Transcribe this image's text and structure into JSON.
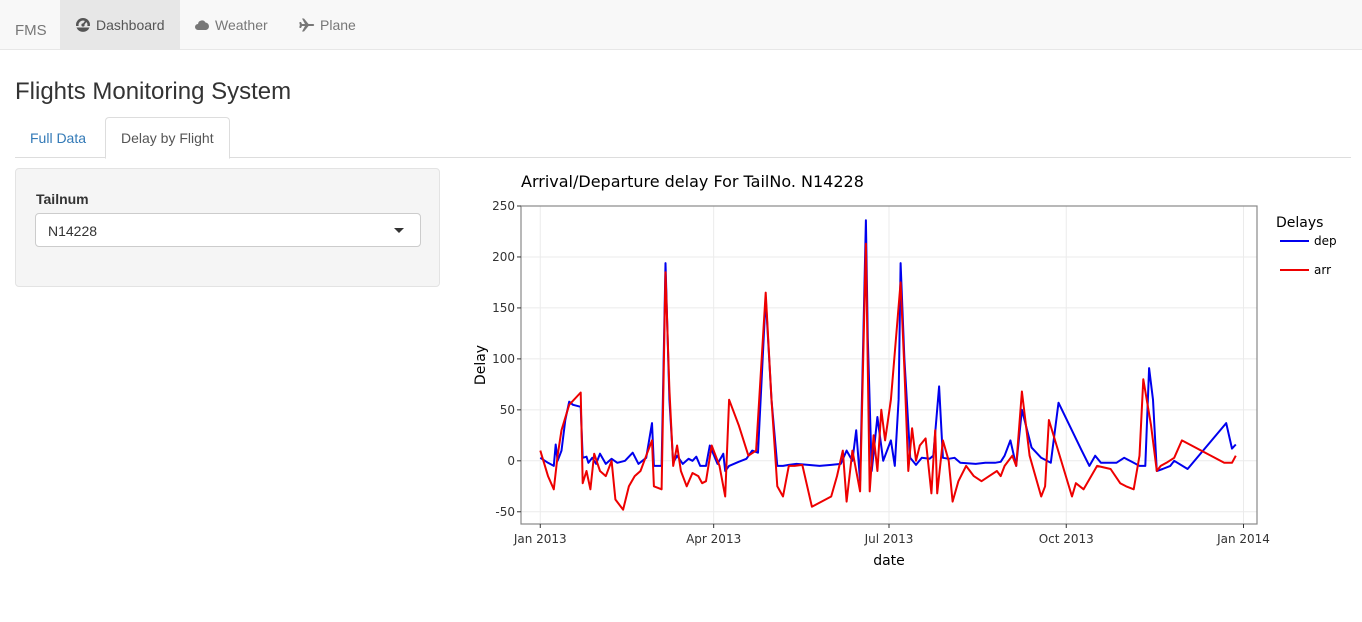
{
  "navbar": {
    "brand": "FMS",
    "items": [
      {
        "label": "Dashboard",
        "icon": "dashboard-icon",
        "active": true
      },
      {
        "label": "Weather",
        "icon": "cloud-icon",
        "active": false
      },
      {
        "label": "Plane",
        "icon": "plane-icon",
        "active": false
      }
    ]
  },
  "page": {
    "title": "Flights Monitoring System"
  },
  "tabs": [
    {
      "label": "Full Data",
      "active": false
    },
    {
      "label": "Delay by Flight",
      "active": true
    }
  ],
  "sidebar": {
    "tailnum_label": "Tailnum",
    "tailnum_value": "N14228"
  },
  "colors": {
    "dep": "#0000ee",
    "arr": "#ee0000",
    "link": "#337ab7"
  },
  "chart_data": {
    "type": "line",
    "title": "Arrival/Departure delay For TailNo. N14228",
    "xlabel": "date",
    "ylabel": "Delay",
    "legend_title": "Delays",
    "legend_position": "right",
    "grid": true,
    "xlim": [
      "2012-12-22",
      "2014-01-08"
    ],
    "ylim": [
      -62,
      250
    ],
    "x_ticks": [
      {
        "date": "2013-01-01",
        "label": "Jan 2013"
      },
      {
        "date": "2013-04-01",
        "label": "Apr 2013"
      },
      {
        "date": "2013-07-01",
        "label": "Jul 2013"
      },
      {
        "date": "2013-10-01",
        "label": "Oct 2013"
      },
      {
        "date": "2014-01-01",
        "label": "Jan 2014"
      }
    ],
    "y_ticks": [
      -50,
      0,
      50,
      100,
      150,
      200,
      250
    ],
    "series": [
      {
        "name": "dep",
        "points": [
          [
            "2013-01-01",
            3
          ],
          [
            "2013-01-05",
            -2
          ],
          [
            "2013-01-08",
            -5
          ],
          [
            "2013-01-09",
            16
          ],
          [
            "2013-01-10",
            0
          ],
          [
            "2013-01-12",
            10
          ],
          [
            "2013-01-14",
            40
          ],
          [
            "2013-01-16",
            58
          ],
          [
            "2013-01-18",
            55
          ],
          [
            "2013-01-22",
            53
          ],
          [
            "2013-01-23",
            3
          ],
          [
            "2013-01-25",
            4
          ],
          [
            "2013-01-26",
            -2
          ],
          [
            "2013-01-28",
            3
          ],
          [
            "2013-01-30",
            -3
          ],
          [
            "2013-02-01",
            7
          ],
          [
            "2013-02-04",
            -3
          ],
          [
            "2013-02-07",
            2
          ],
          [
            "2013-02-10",
            -2
          ],
          [
            "2013-02-14",
            0
          ],
          [
            "2013-02-18",
            8
          ],
          [
            "2013-02-21",
            -3
          ],
          [
            "2013-02-25",
            3
          ],
          [
            "2013-02-28",
            37
          ],
          [
            "2013-03-01",
            -5
          ],
          [
            "2013-03-05",
            -5
          ],
          [
            "2013-03-07",
            194
          ],
          [
            "2013-03-09",
            60
          ],
          [
            "2013-03-11",
            -2
          ],
          [
            "2013-03-13",
            5
          ],
          [
            "2013-03-16",
            -3
          ],
          [
            "2013-03-19",
            2
          ],
          [
            "2013-03-21",
            0
          ],
          [
            "2013-03-23",
            4
          ],
          [
            "2013-03-25",
            -5
          ],
          [
            "2013-03-28",
            -5
          ],
          [
            "2013-03-30",
            15
          ],
          [
            "2013-04-03",
            -3
          ],
          [
            "2013-04-06",
            7
          ],
          [
            "2013-04-07",
            -10
          ],
          [
            "2013-04-09",
            -5
          ],
          [
            "2013-04-14",
            -1
          ],
          [
            "2013-04-18",
            2
          ],
          [
            "2013-04-21",
            10
          ],
          [
            "2013-04-24",
            8
          ],
          [
            "2013-04-28",
            160
          ],
          [
            "2013-05-01",
            60
          ],
          [
            "2013-05-04",
            -5
          ],
          [
            "2013-05-07",
            -5
          ],
          [
            "2013-05-10",
            -4
          ],
          [
            "2013-05-14",
            -3
          ],
          [
            "2013-05-20",
            -4
          ],
          [
            "2013-05-26",
            -5
          ],
          [
            "2013-06-01",
            -4
          ],
          [
            "2013-06-06",
            -3
          ],
          [
            "2013-06-09",
            10
          ],
          [
            "2013-06-12",
            0
          ],
          [
            "2013-06-14",
            30
          ],
          [
            "2013-06-16",
            -20
          ],
          [
            "2013-06-19",
            236
          ],
          [
            "2013-06-20",
            120
          ],
          [
            "2013-06-22",
            -10
          ],
          [
            "2013-06-25",
            43
          ],
          [
            "2013-06-28",
            0
          ],
          [
            "2013-07-02",
            20
          ],
          [
            "2013-07-04",
            -5
          ],
          [
            "2013-07-06",
            60
          ],
          [
            "2013-07-07",
            194
          ],
          [
            "2013-07-09",
            100
          ],
          [
            "2013-07-12",
            3
          ],
          [
            "2013-07-15",
            -4
          ],
          [
            "2013-07-18",
            3
          ],
          [
            "2013-07-22",
            2
          ],
          [
            "2013-07-24",
            5
          ],
          [
            "2013-07-27",
            73
          ],
          [
            "2013-07-29",
            3
          ],
          [
            "2013-08-01",
            2
          ],
          [
            "2013-08-04",
            3
          ],
          [
            "2013-08-07",
            -2
          ],
          [
            "2013-08-15",
            -3
          ],
          [
            "2013-08-20",
            -2
          ],
          [
            "2013-08-25",
            -2
          ],
          [
            "2013-08-28",
            -1
          ],
          [
            "2013-08-30",
            5
          ],
          [
            "2013-09-02",
            20
          ],
          [
            "2013-09-05",
            -5
          ],
          [
            "2013-09-08",
            50
          ],
          [
            "2013-09-13",
            13
          ],
          [
            "2013-09-18",
            3
          ],
          [
            "2013-09-23",
            -2
          ],
          [
            "2013-09-27",
            57
          ],
          [
            "2013-10-09",
            10
          ],
          [
            "2013-10-13",
            -5
          ],
          [
            "2013-10-16",
            5
          ],
          [
            "2013-10-19",
            -2
          ],
          [
            "2013-10-23",
            -2
          ],
          [
            "2013-10-27",
            -2
          ],
          [
            "2013-10-31",
            3
          ],
          [
            "2013-11-04",
            -1
          ],
          [
            "2013-11-08",
            -5
          ],
          [
            "2013-11-11",
            -5
          ],
          [
            "2013-11-13",
            91
          ],
          [
            "2013-11-15",
            60
          ],
          [
            "2013-11-17",
            -10
          ],
          [
            "2013-11-20",
            -8
          ],
          [
            "2013-11-24",
            -5
          ],
          [
            "2013-11-26",
            0
          ],
          [
            "2013-12-03",
            -8
          ],
          [
            "2013-12-23",
            37
          ],
          [
            "2013-12-26",
            12
          ],
          [
            "2013-12-28",
            16
          ]
        ]
      },
      {
        "name": "arr",
        "points": [
          [
            "2013-01-01",
            10
          ],
          [
            "2013-01-05",
            -15
          ],
          [
            "2013-01-08",
            -28
          ],
          [
            "2013-01-10",
            5
          ],
          [
            "2013-01-12",
            30
          ],
          [
            "2013-01-16",
            55
          ],
          [
            "2013-01-22",
            67
          ],
          [
            "2013-01-23",
            -22
          ],
          [
            "2013-01-25",
            -10
          ],
          [
            "2013-01-27",
            -28
          ],
          [
            "2013-01-29",
            7
          ],
          [
            "2013-02-01",
            -10
          ],
          [
            "2013-02-04",
            -15
          ],
          [
            "2013-02-07",
            0
          ],
          [
            "2013-02-09",
            -38
          ],
          [
            "2013-02-13",
            -48
          ],
          [
            "2013-02-16",
            -25
          ],
          [
            "2013-02-19",
            -15
          ],
          [
            "2013-02-22",
            -10
          ],
          [
            "2013-02-25",
            5
          ],
          [
            "2013-02-28",
            20
          ],
          [
            "2013-03-01",
            -25
          ],
          [
            "2013-03-05",
            -28
          ],
          [
            "2013-03-07",
            185
          ],
          [
            "2013-03-09",
            70
          ],
          [
            "2013-03-11",
            -5
          ],
          [
            "2013-03-13",
            15
          ],
          [
            "2013-03-15",
            -10
          ],
          [
            "2013-03-18",
            -25
          ],
          [
            "2013-03-21",
            -12
          ],
          [
            "2013-03-24",
            -15
          ],
          [
            "2013-03-26",
            -22
          ],
          [
            "2013-03-28",
            -20
          ],
          [
            "2013-03-31",
            15
          ],
          [
            "2013-04-04",
            -5
          ],
          [
            "2013-04-07",
            -35
          ],
          [
            "2013-04-09",
            60
          ],
          [
            "2013-04-14",
            35
          ],
          [
            "2013-04-19",
            5
          ],
          [
            "2013-04-23",
            10
          ],
          [
            "2013-04-28",
            165
          ],
          [
            "2013-05-01",
            60
          ],
          [
            "2013-05-04",
            -25
          ],
          [
            "2013-05-07",
            -35
          ],
          [
            "2013-05-10",
            -5
          ],
          [
            "2013-05-13",
            -5
          ],
          [
            "2013-05-17",
            -4
          ],
          [
            "2013-05-22",
            -45
          ],
          [
            "2013-06-01",
            -35
          ],
          [
            "2013-06-04",
            -15
          ],
          [
            "2013-06-07",
            10
          ],
          [
            "2013-06-09",
            -40
          ],
          [
            "2013-06-12",
            10
          ],
          [
            "2013-06-16",
            -30
          ],
          [
            "2013-06-19",
            213
          ],
          [
            "2013-06-21",
            -30
          ],
          [
            "2013-06-23",
            25
          ],
          [
            "2013-06-25",
            -10
          ],
          [
            "2013-06-27",
            50
          ],
          [
            "2013-06-29",
            20
          ],
          [
            "2013-07-02",
            60
          ],
          [
            "2013-07-07",
            175
          ],
          [
            "2013-07-09",
            90
          ],
          [
            "2013-07-11",
            -10
          ],
          [
            "2013-07-13",
            32
          ],
          [
            "2013-07-15",
            0
          ],
          [
            "2013-07-17",
            15
          ],
          [
            "2013-07-20",
            22
          ],
          [
            "2013-07-23",
            -32
          ],
          [
            "2013-07-25",
            30
          ],
          [
            "2013-07-26",
            -32
          ],
          [
            "2013-07-29",
            20
          ],
          [
            "2013-08-01",
            0
          ],
          [
            "2013-08-03",
            -40
          ],
          [
            "2013-08-06",
            -20
          ],
          [
            "2013-08-10",
            -5
          ],
          [
            "2013-08-14",
            -15
          ],
          [
            "2013-08-18",
            -20
          ],
          [
            "2013-08-22",
            -15
          ],
          [
            "2013-08-26",
            -10
          ],
          [
            "2013-08-28",
            -15
          ],
          [
            "2013-08-30",
            -5
          ],
          [
            "2013-09-03",
            5
          ],
          [
            "2013-09-05",
            -5
          ],
          [
            "2013-09-08",
            68
          ],
          [
            "2013-09-12",
            5
          ],
          [
            "2013-09-18",
            -35
          ],
          [
            "2013-09-20",
            -25
          ],
          [
            "2013-09-22",
            40
          ],
          [
            "2013-10-04",
            -35
          ],
          [
            "2013-10-06",
            -22
          ],
          [
            "2013-10-10",
            -28
          ],
          [
            "2013-10-17",
            -5
          ],
          [
            "2013-10-24",
            -8
          ],
          [
            "2013-10-29",
            -22
          ],
          [
            "2013-11-01",
            -25
          ],
          [
            "2013-11-05",
            -28
          ],
          [
            "2013-11-08",
            5
          ],
          [
            "2013-11-10",
            80
          ],
          [
            "2013-11-14",
            35
          ],
          [
            "2013-11-17",
            -10
          ],
          [
            "2013-11-19",
            -5
          ],
          [
            "2013-11-22",
            -2
          ],
          [
            "2013-11-26",
            3
          ],
          [
            "2013-11-30",
            20
          ],
          [
            "2013-12-22",
            -2
          ],
          [
            "2013-12-26",
            -2
          ],
          [
            "2013-12-28",
            5
          ]
        ]
      }
    ]
  }
}
